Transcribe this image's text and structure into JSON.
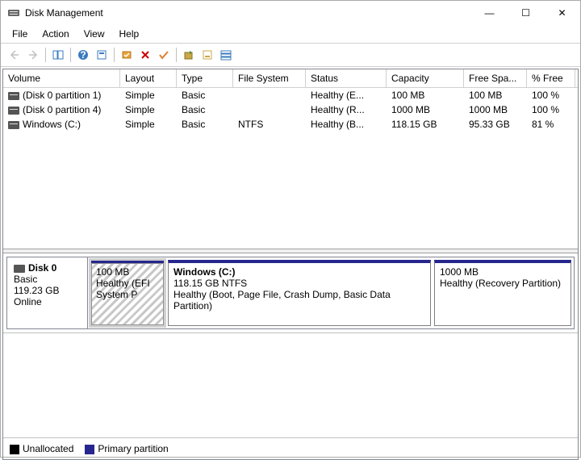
{
  "window": {
    "title": "Disk Management",
    "minimize_glyph": "—",
    "maximize_glyph": "☐",
    "close_glyph": "✕"
  },
  "menubar": {
    "file": "File",
    "action": "Action",
    "view": "View",
    "help": "Help"
  },
  "columns": {
    "volume": "Volume",
    "layout": "Layout",
    "type": "Type",
    "filesystem": "File System",
    "status": "Status",
    "capacity": "Capacity",
    "freespace": "Free Spa...",
    "percentfree": "% Free"
  },
  "volumes": [
    {
      "name": "(Disk 0 partition 1)",
      "layout": "Simple",
      "type": "Basic",
      "fs": "",
      "status": "Healthy (E...",
      "capacity": "100 MB",
      "free": "100 MB",
      "pct": "100 %"
    },
    {
      "name": "(Disk 0 partition 4)",
      "layout": "Simple",
      "type": "Basic",
      "fs": "",
      "status": "Healthy (R...",
      "capacity": "1000 MB",
      "free": "1000 MB",
      "pct": "100 %"
    },
    {
      "name": "Windows (C:)",
      "layout": "Simple",
      "type": "Basic",
      "fs": "NTFS",
      "status": "Healthy (B...",
      "capacity": "118.15 GB",
      "free": "95.33 GB",
      "pct": "81 %"
    }
  ],
  "disk": {
    "label": "Disk 0",
    "type": "Basic",
    "size": "119.23 GB",
    "status": "Online"
  },
  "partitions": {
    "p0_size": "100 MB",
    "p0_status": "Healthy (EFI System P",
    "p1_title": "Windows  (C:)",
    "p1_size": "118.15 GB NTFS",
    "p1_status": "Healthy (Boot, Page File, Crash Dump, Basic Data Partition)",
    "p2_size": "1000 MB",
    "p2_status": "Healthy (Recovery Partition)"
  },
  "legend": {
    "unallocated": "Unallocated",
    "primary": "Primary partition"
  }
}
